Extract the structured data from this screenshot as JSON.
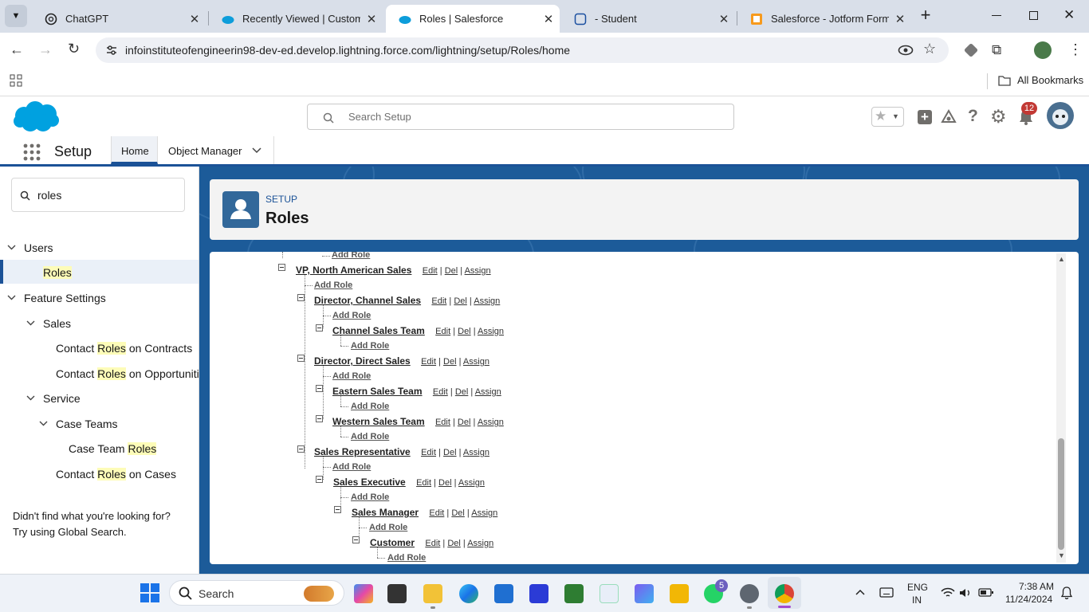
{
  "browser": {
    "tabs": [
      {
        "title": "ChatGPT"
      },
      {
        "title": "Recently Viewed | Customer"
      },
      {
        "title": "Roles | Salesforce"
      },
      {
        "title": "- Student"
      },
      {
        "title": "Salesforce - Jotform Form Bu"
      }
    ],
    "url": "infoinstituteofengineerin98-dev-ed.develop.lightning.force.com/lightning/setup/Roles/home",
    "all_bookmarks": "All Bookmarks"
  },
  "header": {
    "search_placeholder": "Search Setup",
    "notification_count": "12"
  },
  "nav": {
    "app_name": "Setup",
    "tabs": [
      {
        "label": "Home"
      },
      {
        "label": "Object Manager"
      }
    ]
  },
  "sidebar": {
    "search_value": "roles",
    "users": "Users",
    "roles": "Roles",
    "feature_settings": "Feature Settings",
    "sales": "Sales",
    "contact_pre": "Contact ",
    "roles_word": "Roles",
    "on_contracts": " on Contracts",
    "on_opportunities": " on Opportunities",
    "service": "Service",
    "case_teams": "Case Teams",
    "case_team_pre": "Case Team ",
    "on_cases": " on Cases",
    "not_found_1": "Didn't find what you're looking for?",
    "not_found_2": "Try using Global Search."
  },
  "page": {
    "eyebrow": "SETUP",
    "title": "Roles"
  },
  "hierarchy": {
    "add_role": "Add Role",
    "edit": "Edit",
    "del": "Del",
    "assign": "Assign",
    "roles": [
      {
        "name": "VP, North American Sales"
      },
      {
        "name": "Director, Channel Sales"
      },
      {
        "name": "Channel Sales Team"
      },
      {
        "name": "Director, Direct Sales"
      },
      {
        "name": "Eastern Sales Team"
      },
      {
        "name": "Western Sales Team"
      },
      {
        "name": "Sales Representative"
      },
      {
        "name": "Sales Executive"
      },
      {
        "name": "Sales Manager"
      },
      {
        "name": "Customer"
      }
    ]
  },
  "taskbar": {
    "search": "Search",
    "lang1": "ENG",
    "lang2": "IN",
    "time": "7:38 AM",
    "date": "11/24/2024",
    "whatsapp_badge": "5"
  }
}
